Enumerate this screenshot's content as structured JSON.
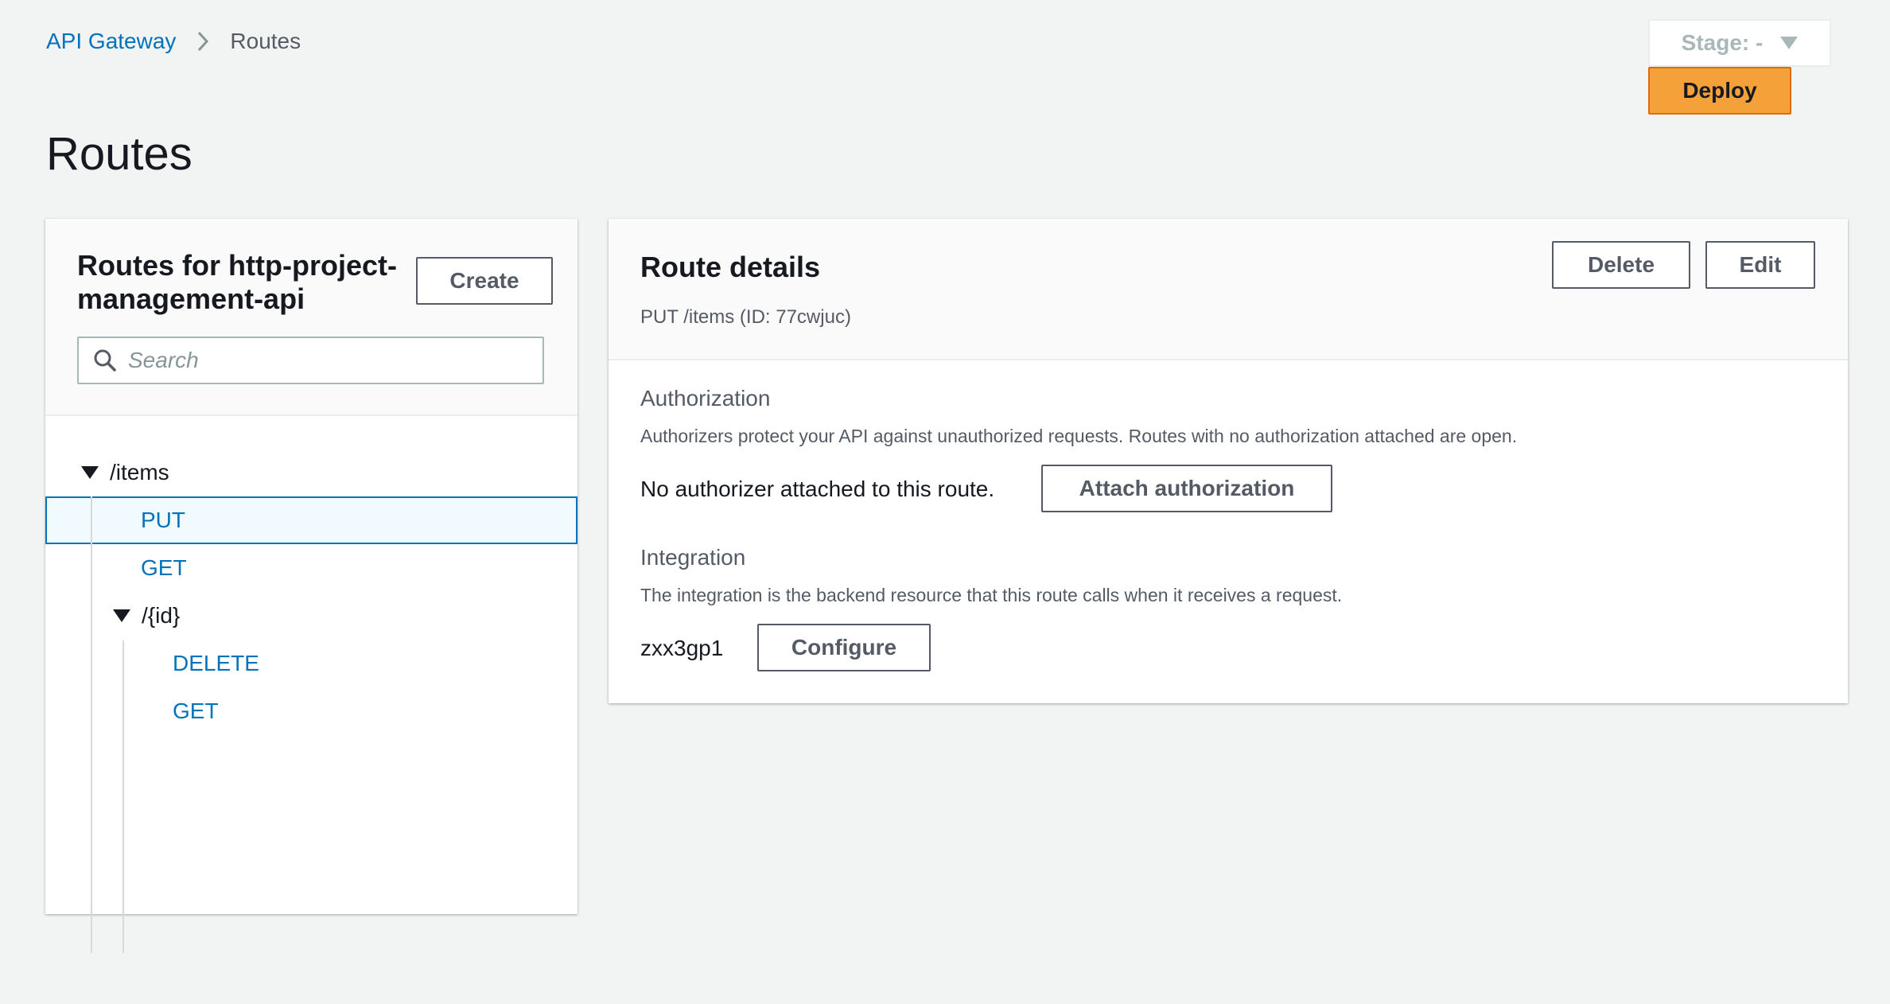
{
  "breadcrumb": {
    "root": "API Gateway",
    "current": "Routes"
  },
  "stage": {
    "label": "Stage: -"
  },
  "deploy": {
    "label": "Deploy"
  },
  "page": {
    "title": "Routes"
  },
  "routes_panel": {
    "title": "Routes for http-project-management-api",
    "create_label": "Create",
    "search_placeholder": "Search",
    "tree": {
      "items_path": "/items",
      "items_methods": [
        "PUT",
        "GET"
      ],
      "id_path": "/{id}",
      "id_methods": [
        "DELETE",
        "GET"
      ],
      "selected": "PUT"
    }
  },
  "details": {
    "title": "Route details",
    "subtitle": "PUT /items (ID: 77cwjuc)",
    "delete_label": "Delete",
    "edit_label": "Edit",
    "authorization": {
      "title": "Authorization",
      "description": "Authorizers protect your API against unauthorized requests. Routes with no authorization attached are open.",
      "status": "No authorizer attached to this route.",
      "attach_label": "Attach authorization"
    },
    "integration": {
      "title": "Integration",
      "description": "The integration is the backend resource that this route calls when it receives a request.",
      "value": "zxx3gp1",
      "configure_label": "Configure"
    }
  },
  "colors": {
    "link": "#0073bb",
    "deploy_bg": "#f5a13a",
    "selected_bg": "#f1faff",
    "page_bg": "#f2f3f3"
  },
  "icons": [
    "chevron-right-icon",
    "caret-down-icon",
    "search-icon",
    "expand-triangle-icon"
  ]
}
